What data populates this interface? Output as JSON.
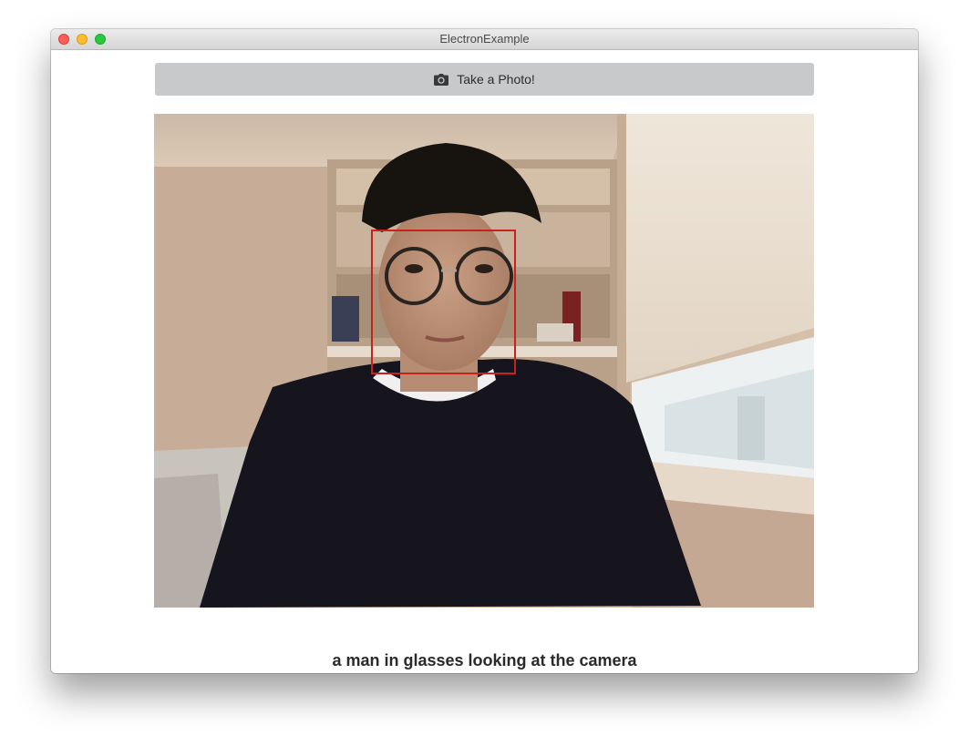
{
  "window": {
    "title": "ElectronExample"
  },
  "toolbar": {
    "button_label": "Take a Photo!",
    "button_icon": "camera-icon"
  },
  "feed": {
    "subject": "webcam-frame",
    "face_box_color": "#c8221c"
  },
  "result": {
    "caption": "a man in glasses looking at the camera"
  },
  "colors": {
    "button_bg": "#c8c9cb",
    "face_box": "#c8221c"
  }
}
